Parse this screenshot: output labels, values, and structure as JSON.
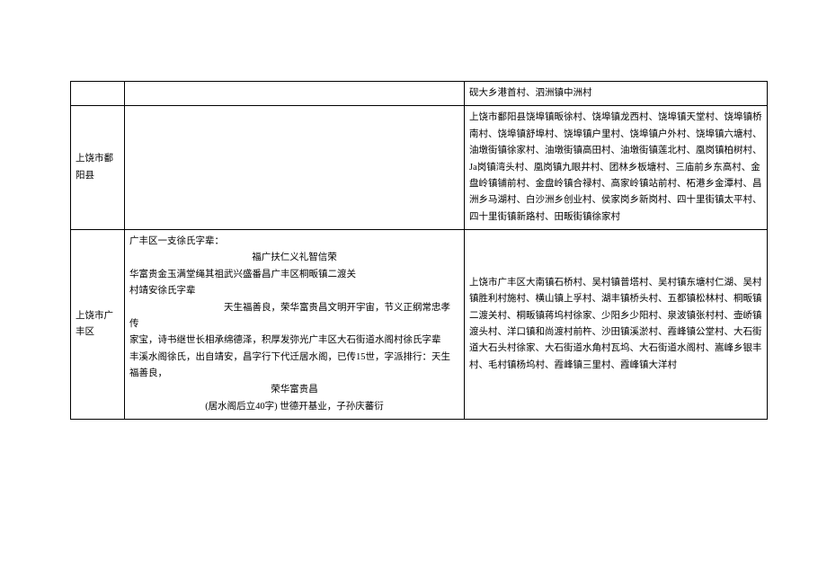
{
  "rows": [
    {
      "col1": "",
      "col2": "",
      "col3": "砚大乡港首村、泗洲镇中洲村"
    },
    {
      "col1": "上饶市鄱阳县",
      "col2": "",
      "col3": "上饶市鄱阳县饶埠镇畈徐村、饶埠镇龙西村、饶埠镇天堂村、饶埠镇桥南村、饶埠镇舒埠村、饶埠镇户里村、饶埠镇户外村、饶埠镇六塘村、油墩街镇徐家村、油墩街镇高田村、油墩街镇莲北村、凰岗镇柏树村、Ja岗镇湾头村、凰岗镇九眼井村、团林乡板塘村、三庙前乡东高村、金盘岭镇铺前村、金盘岭镇合禄村、高家岭镇站前村、柘港乡金潭村、昌洲乡马湖村、白沙洲乡创业村、侯家岗乡新岗村、四十里街镇太平村、四十里街镇新路村、田畈街镇徐家村"
    },
    {
      "col1": "上饶市广丰区",
      "col2_lines": [
        "广丰区一支徐氏字辈：",
        {
          "text": "福广扶仁义礼智信荣",
          "center": true
        },
        "华富贵金玉满堂绳其祖武兴盛番昌广丰区桐畈镇二渡关",
        "村靖安徐氏字辈",
        "　　　　　　　　　　天生福善良，荣华富贵昌文明开宇宙，节义正纲常忠孝传",
        "家宝，诗书继世长相承绵德泽，积厚发弥光广丰区大石街道水阁村徐氏字辈",
        "丰溪水阁徐氏，出自靖安，昌字行下代迁居水阁，已传15世，字派排行：天生福善良，",
        {
          "text": "荣华富贵昌",
          "center": true
        },
        {
          "text": "(居水阁后立40字) 世德开基业，子孙庆蕃衍",
          "center": true
        }
      ],
      "col3": "上饶市广丰区大南镇石桥村、吴村镇普塔村、吴村镇东塘村仁湖、吴村镇胜利村施村、横山镇上孚村、湖丰镇桥头村、五都镇松林村、桐畈镇二渡关村、桐畈镇蒋坞村徐家、少阳乡少阳村、泉波镇张村村、壶峤镇渡头村、洋口镇和尚渡村前杵、沙田镇溪淤村、霞峰镇公堂村、大石街道大石头村徐家、大石街道水角村瓦坞、大石街道水阁村、嵩峰乡银丰村、毛村镇杨坞村、霞峰镇三里村、霞峰镇大洋村"
    }
  ]
}
